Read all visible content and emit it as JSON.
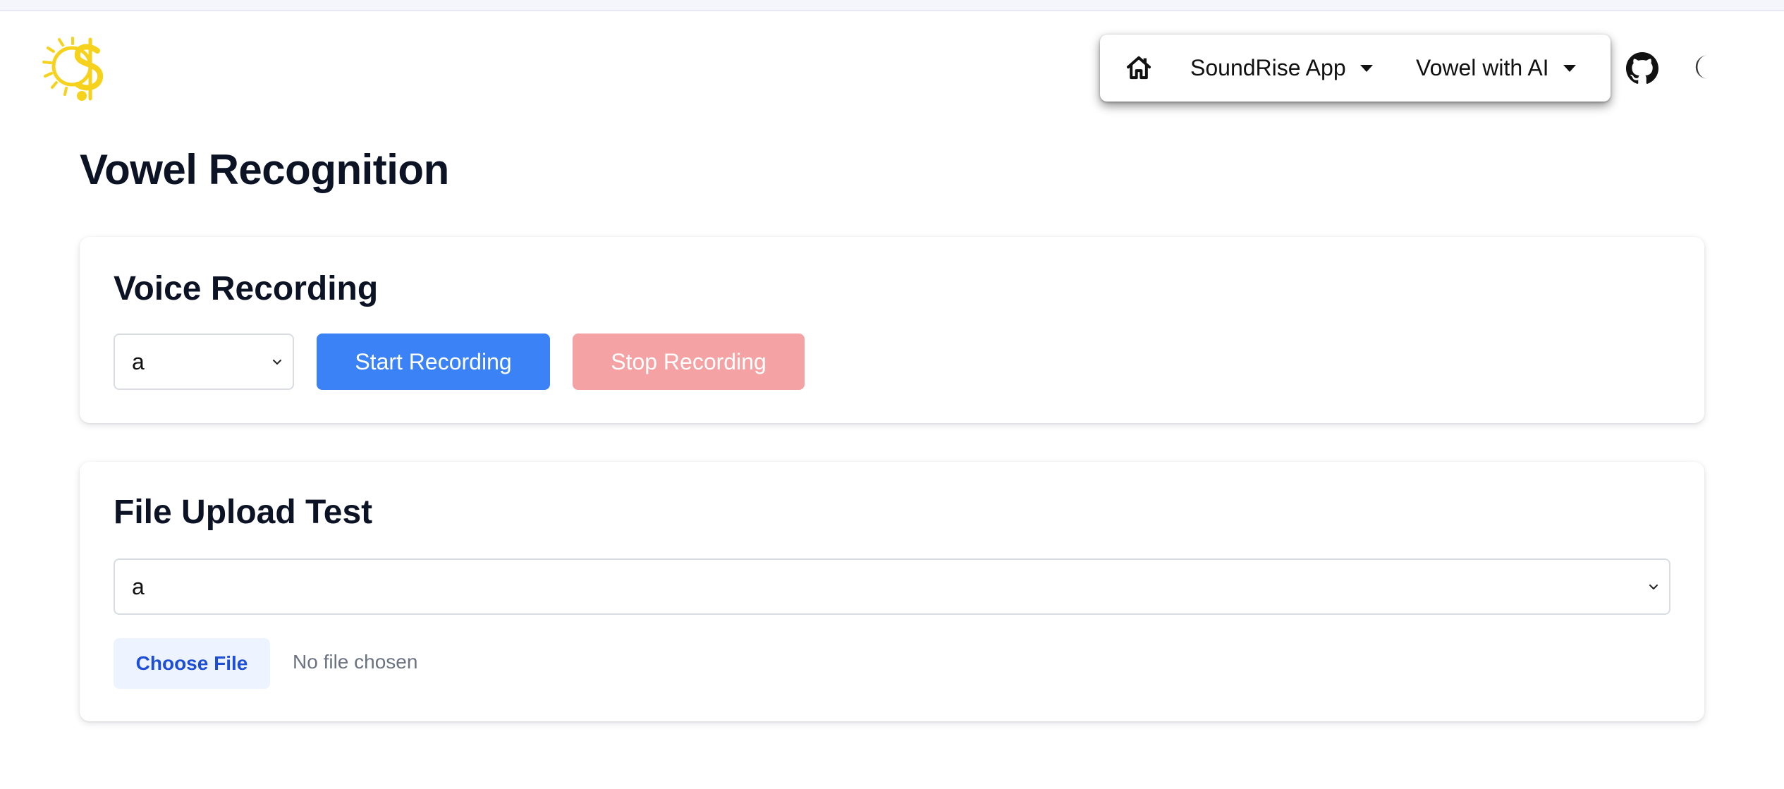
{
  "nav": {
    "home_icon": "home-icon",
    "menus": [
      {
        "label": "SoundRise App"
      },
      {
        "label": "Vowel with AI"
      }
    ],
    "github_icon": "github-icon",
    "theme_icon": "moon-icon"
  },
  "page": {
    "title": "Vowel Recognition"
  },
  "voice_recording": {
    "title": "Voice Recording",
    "vowel_select_value": "a",
    "start_label": "Start Recording",
    "stop_label": "Stop Recording"
  },
  "file_upload": {
    "title": "File Upload Test",
    "vowel_select_value": "a",
    "choose_file_label": "Choose File",
    "file_status": "No file chosen"
  },
  "colors": {
    "primary": "#3b82f6",
    "stop_disabled": "#f4a2a3",
    "file_button_bg": "#eef4ff",
    "file_button_text": "#1d4ed8",
    "logo_yellow": "#f6d21c"
  }
}
